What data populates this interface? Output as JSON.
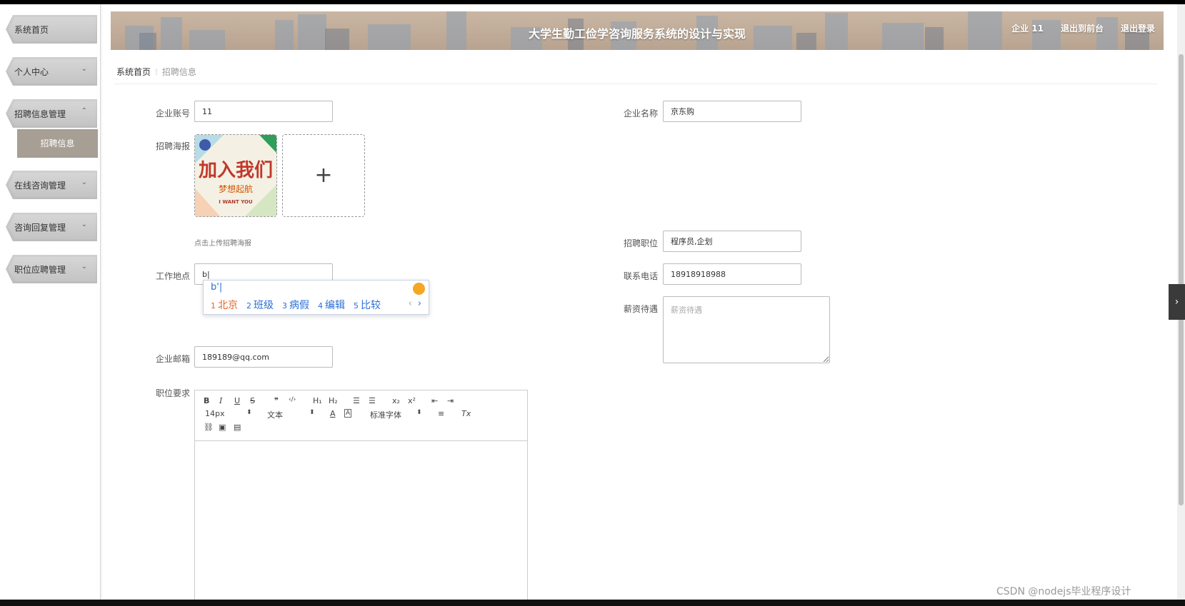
{
  "sidebar": {
    "items": [
      {
        "label": "系统首页",
        "has_chevron": false
      },
      {
        "label": "个人中心",
        "chevron": "⌄"
      },
      {
        "label": "招聘信息管理",
        "chevron": "⌃"
      },
      {
        "label": "在线咨询管理",
        "chevron": "⌄"
      },
      {
        "label": "咨询回复管理",
        "chevron": "⌄"
      },
      {
        "label": "职位应聘管理",
        "chevron": "⌄"
      }
    ],
    "active_sub": "招聘信息"
  },
  "header": {
    "title": "大学生勤工俭学咨询服务系统的设计与实现",
    "user": "企业 11",
    "to_front": "退出到前台",
    "logout": "退出登录"
  },
  "breadcrumb": {
    "home": "系统首页",
    "current": "招聘信息"
  },
  "form": {
    "account_label": "企业账号",
    "account_value": "11",
    "company_label": "企业名称",
    "company_value": "京东购",
    "poster_label": "招聘海报",
    "poster_hint": "点击上传招聘海报",
    "upload_plus": "+",
    "poster_text": {
      "line1": "加入我们",
      "line2": "梦想起航",
      "line3": "I WANT YOU"
    },
    "position_label": "招聘职位",
    "position_value": "程序员,企划",
    "location_label": "工作地点",
    "location_value": "b|",
    "phone_label": "联系电话",
    "phone_value": "18918918988",
    "salary_label": "薪资待遇",
    "salary_placeholder": "薪资待遇",
    "email_label": "企业邮箱",
    "email_value": "189189@qq.com",
    "requirements_label": "职位要求"
  },
  "ime": {
    "composition": "b'|",
    "candidates": [
      {
        "n": "1",
        "text": "北京"
      },
      {
        "n": "2",
        "text": "班级"
      },
      {
        "n": "3",
        "text": "病假"
      },
      {
        "n": "4",
        "text": "编辑"
      },
      {
        "n": "5",
        "text": "比较"
      }
    ],
    "prev": "‹",
    "next": "›"
  },
  "editor": {
    "bold": "B",
    "italic": "I",
    "underline": "U",
    "strike": "S",
    "quote": "❞",
    "code": "‹/›",
    "h1": "H₁",
    "h2": "H₂",
    "ordered": "☰",
    "bullet": "☰",
    "sub": "x₂",
    "sup": "x²",
    "outdent": "⇤",
    "indent": "⇥",
    "size": "14px",
    "header": "文本",
    "font": "标准字体",
    "sel": "⬍",
    "color": "A",
    "bg": "A",
    "align": "≡",
    "clean": "Tx",
    "link": "⛓",
    "image": "▣",
    "video": "▤"
  },
  "side_toggle": "›",
  "watermark": "CSDN @nodejs毕业程序设计"
}
